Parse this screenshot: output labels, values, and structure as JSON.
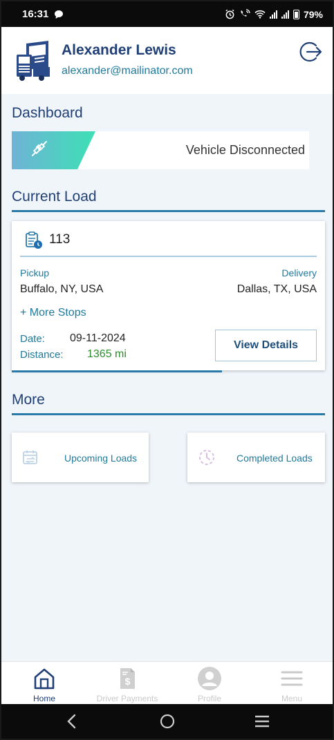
{
  "status_bar": {
    "time": "16:31",
    "battery": "79%"
  },
  "user": {
    "name": "Alexander Lewis",
    "email": "alexander@mailinator.com"
  },
  "dashboard": {
    "title": "Dashboard",
    "vehicle_status": "Vehicle Disconnected"
  },
  "current_load": {
    "title": "Current Load",
    "load_number": "113",
    "pickup_label": "Pickup",
    "pickup_value": "Buffalo, NY, USA",
    "delivery_label": "Delivery",
    "delivery_value": "Dallas, TX, USA",
    "more_stops": "+ More Stops",
    "date_label": "Date:",
    "date_value": "09-11-2024",
    "distance_label": "Distance:",
    "distance_value": "1365 mi",
    "view_details": "View Details"
  },
  "more": {
    "title": "More",
    "upcoming": "Upcoming Loads",
    "completed": "Completed Loads"
  },
  "bottom_nav": {
    "home": "Home",
    "payments": "Driver Payments",
    "profile": "Profile",
    "menu": "Menu"
  },
  "colors": {
    "primary": "#1f3f75",
    "accent": "#1f7a9c",
    "distance": "#2e8b2e",
    "banner_gradient_start": "#6fb3d6",
    "banner_gradient_end": "#3de0b5"
  }
}
